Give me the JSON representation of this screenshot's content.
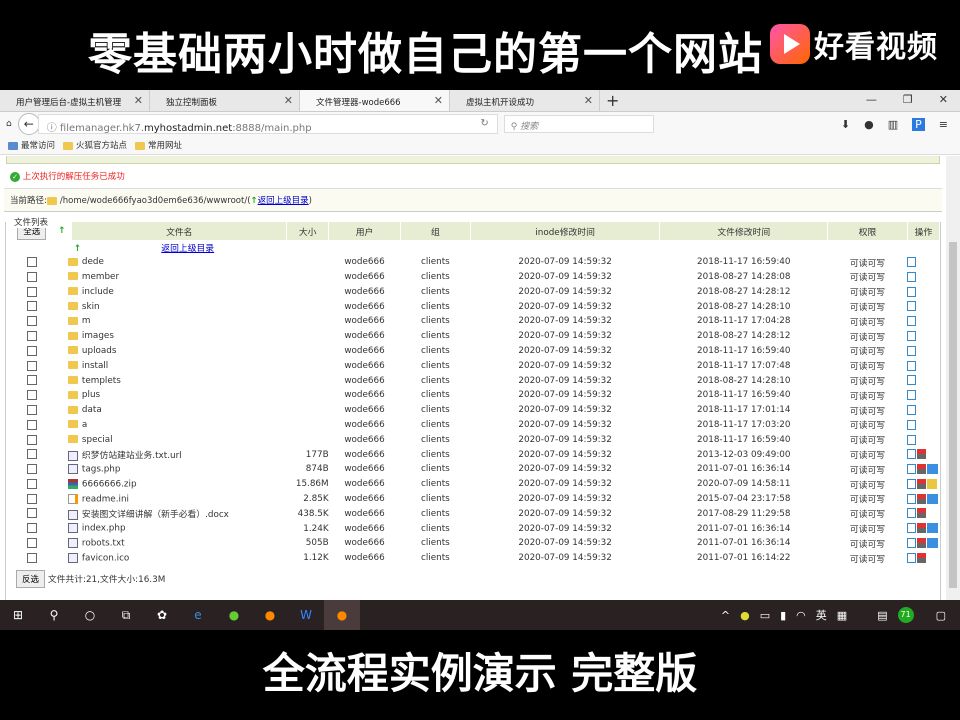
{
  "video": {
    "title": "零基础两小时做自己的第一个网站",
    "logo": "好看视频",
    "caption": "全流程实例演示 完整版"
  },
  "browser": {
    "tabs": [
      {
        "label": "用户管理后台-虚拟主机管理",
        "active": false
      },
      {
        "label": "独立控制面板",
        "active": false
      },
      {
        "label": "文件管理器-wode666",
        "active": true
      },
      {
        "label": "虚拟主机开设成功",
        "active": false
      }
    ],
    "url_prefix": "filemanager.hk7.",
    "url_domain": "myhostadmin.net",
    "url_suffix": ":8888/main.php",
    "search_placeholder": "搜索",
    "bookmarks": [
      "最常访问",
      "火狐官方站点",
      "常用网址"
    ]
  },
  "page": {
    "status_message": "上次执行的解压任务已成功",
    "path_label": "当前路径:",
    "path": "/home/wode666fyao3d0em6e636/wwwroot/",
    "parent_link": "返回上级目录",
    "fieldset_legend": "文件列表",
    "select_all": "全选",
    "invert_select": "反选",
    "summary": "文件共计:21,文件大小:16.3M",
    "columns": [
      "文件名",
      "大小",
      "用户",
      "组",
      "inode修改时间",
      "文件修改时间",
      "权限",
      "操作"
    ],
    "files": [
      {
        "name": "dede",
        "type": "dir",
        "size": "",
        "user": "wode666",
        "group": "clients",
        "inode": "2020-07-09 14:59:32",
        "mtime": "2018-11-17 16:59:40",
        "perm": "可读可写",
        "actions": [
          "rename"
        ]
      },
      {
        "name": "member",
        "type": "dir",
        "size": "",
        "user": "wode666",
        "group": "clients",
        "inode": "2020-07-09 14:59:32",
        "mtime": "2018-08-27 14:28:08",
        "perm": "可读可写",
        "actions": [
          "rename"
        ]
      },
      {
        "name": "include",
        "type": "dir",
        "size": "",
        "user": "wode666",
        "group": "clients",
        "inode": "2020-07-09 14:59:32",
        "mtime": "2018-08-27 14:28:12",
        "perm": "可读可写",
        "actions": [
          "rename"
        ]
      },
      {
        "name": "skin",
        "type": "dir",
        "size": "",
        "user": "wode666",
        "group": "clients",
        "inode": "2020-07-09 14:59:32",
        "mtime": "2018-08-27 14:28:10",
        "perm": "可读可写",
        "actions": [
          "rename"
        ]
      },
      {
        "name": "m",
        "type": "dir",
        "size": "",
        "user": "wode666",
        "group": "clients",
        "inode": "2020-07-09 14:59:32",
        "mtime": "2018-11-17 17:04:28",
        "perm": "可读可写",
        "actions": [
          "rename"
        ]
      },
      {
        "name": "images",
        "type": "dir",
        "size": "",
        "user": "wode666",
        "group": "clients",
        "inode": "2020-07-09 14:59:32",
        "mtime": "2018-08-27 14:28:12",
        "perm": "可读可写",
        "actions": [
          "rename"
        ]
      },
      {
        "name": "uploads",
        "type": "dir",
        "size": "",
        "user": "wode666",
        "group": "clients",
        "inode": "2020-07-09 14:59:32",
        "mtime": "2018-11-17 16:59:40",
        "perm": "可读可写",
        "actions": [
          "rename"
        ]
      },
      {
        "name": "install",
        "type": "dir",
        "size": "",
        "user": "wode666",
        "group": "clients",
        "inode": "2020-07-09 14:59:32",
        "mtime": "2018-11-17 17:07:48",
        "perm": "可读可写",
        "actions": [
          "rename"
        ]
      },
      {
        "name": "templets",
        "type": "dir",
        "size": "",
        "user": "wode666",
        "group": "clients",
        "inode": "2020-07-09 14:59:32",
        "mtime": "2018-08-27 14:28:10",
        "perm": "可读可写",
        "actions": [
          "rename"
        ]
      },
      {
        "name": "plus",
        "type": "dir",
        "size": "",
        "user": "wode666",
        "group": "clients",
        "inode": "2020-07-09 14:59:32",
        "mtime": "2018-11-17 16:59:40",
        "perm": "可读可写",
        "actions": [
          "rename"
        ]
      },
      {
        "name": "data",
        "type": "dir",
        "size": "",
        "user": "wode666",
        "group": "clients",
        "inode": "2020-07-09 14:59:32",
        "mtime": "2018-11-17 17:01:14",
        "perm": "可读可写",
        "actions": [
          "rename"
        ]
      },
      {
        "name": "a",
        "type": "dir",
        "size": "",
        "user": "wode666",
        "group": "clients",
        "inode": "2020-07-09 14:59:32",
        "mtime": "2018-11-17 17:03:20",
        "perm": "可读可写",
        "actions": [
          "rename"
        ]
      },
      {
        "name": "special",
        "type": "dir",
        "size": "",
        "user": "wode666",
        "group": "clients",
        "inode": "2020-07-09 14:59:32",
        "mtime": "2018-11-17 16:59:40",
        "perm": "可读可写",
        "actions": [
          "rename"
        ]
      },
      {
        "name": "织梦仿站建站业务.txt.url",
        "type": "file",
        "size": "177B",
        "user": "wode666",
        "group": "clients",
        "inode": "2020-07-09 14:59:32",
        "mtime": "2013-12-03 09:49:00",
        "perm": "可读可写",
        "actions": [
          "rename",
          "download"
        ]
      },
      {
        "name": "tags.php",
        "type": "file",
        "size": "874B",
        "user": "wode666",
        "group": "clients",
        "inode": "2020-07-09 14:59:32",
        "mtime": "2011-07-01 16:36:14",
        "perm": "可读可写",
        "actions": [
          "rename",
          "download",
          "edit"
        ]
      },
      {
        "name": "6666666.zip",
        "type": "zip",
        "size": "15.86M",
        "user": "wode666",
        "group": "clients",
        "inode": "2020-07-09 14:59:32",
        "mtime": "2020-07-09 14:58:11",
        "perm": "可读可写",
        "actions": [
          "rename",
          "download",
          "extract"
        ]
      },
      {
        "name": "readme.ini",
        "type": "ini",
        "size": "2.85K",
        "user": "wode666",
        "group": "clients",
        "inode": "2020-07-09 14:59:32",
        "mtime": "2015-07-04 23:17:58",
        "perm": "可读可写",
        "actions": [
          "rename",
          "download",
          "edit"
        ]
      },
      {
        "name": "安装图文详细讲解（新手必看）.docx",
        "type": "file",
        "size": "438.5K",
        "user": "wode666",
        "group": "clients",
        "inode": "2020-07-09 14:59:32",
        "mtime": "2017-08-29 11:29:58",
        "perm": "可读可写",
        "actions": [
          "rename",
          "download"
        ]
      },
      {
        "name": "index.php",
        "type": "file",
        "size": "1.24K",
        "user": "wode666",
        "group": "clients",
        "inode": "2020-07-09 14:59:32",
        "mtime": "2011-07-01 16:36:14",
        "perm": "可读可写",
        "actions": [
          "rename",
          "download",
          "edit"
        ]
      },
      {
        "name": "robots.txt",
        "type": "file",
        "size": "505B",
        "user": "wode666",
        "group": "clients",
        "inode": "2020-07-09 14:59:32",
        "mtime": "2011-07-01 16:36:14",
        "perm": "可读可写",
        "actions": [
          "rename",
          "download",
          "edit"
        ]
      },
      {
        "name": "favicon.ico",
        "type": "file",
        "size": "1.12K",
        "user": "wode666",
        "group": "clients",
        "inode": "2020-07-09 14:59:32",
        "mtime": "2011-07-01 16:14:22",
        "perm": "可读可写",
        "actions": [
          "rename",
          "download"
        ]
      }
    ]
  },
  "taskbar": {
    "ime": "英",
    "badge": "71"
  }
}
